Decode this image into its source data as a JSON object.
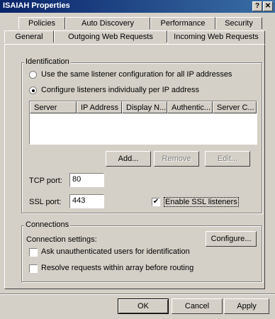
{
  "window": {
    "title": "ISAIAH Properties",
    "help_glyph": "?",
    "close_glyph": "✕"
  },
  "tabs_row_back": [
    {
      "label": "Policies"
    },
    {
      "label": "Auto Discovery"
    },
    {
      "label": "Performance"
    },
    {
      "label": "Security"
    }
  ],
  "tabs_row_front": [
    {
      "label": "General"
    },
    {
      "label": "Outgoing Web Requests"
    },
    {
      "label": "Incoming Web Requests",
      "active": true
    }
  ],
  "identification": {
    "legend": "Identification",
    "radio_same": {
      "label": "Use the same listener configuration for all IP addresses",
      "selected": false
    },
    "radio_individual": {
      "label": "Configure listeners individually per IP address",
      "selected": true
    },
    "table_headers": [
      "Server",
      "IP Address",
      "Display N...",
      "Authentic...",
      "Server C..."
    ],
    "table_rows": [],
    "buttons": {
      "add": "Add...",
      "remove": "Remove",
      "edit": "Edit..."
    },
    "tcp_port_label": "TCP port:",
    "tcp_port_value": "80",
    "ssl_port_label": "SSL port:",
    "ssl_port_value": "443",
    "enable_ssl_label": "Enable SSL listeners",
    "enable_ssl_checked": true,
    "check_glyph": "✔"
  },
  "connections": {
    "legend": "Connections",
    "settings_label": "Connection settings:",
    "configure_button": "Configure...",
    "ask_unauth_label": "Ask unauthenticated users for identification",
    "resolve_label": "Resolve requests within array before routing"
  },
  "footer": {
    "ok": "OK",
    "cancel": "Cancel",
    "apply": "Apply"
  }
}
